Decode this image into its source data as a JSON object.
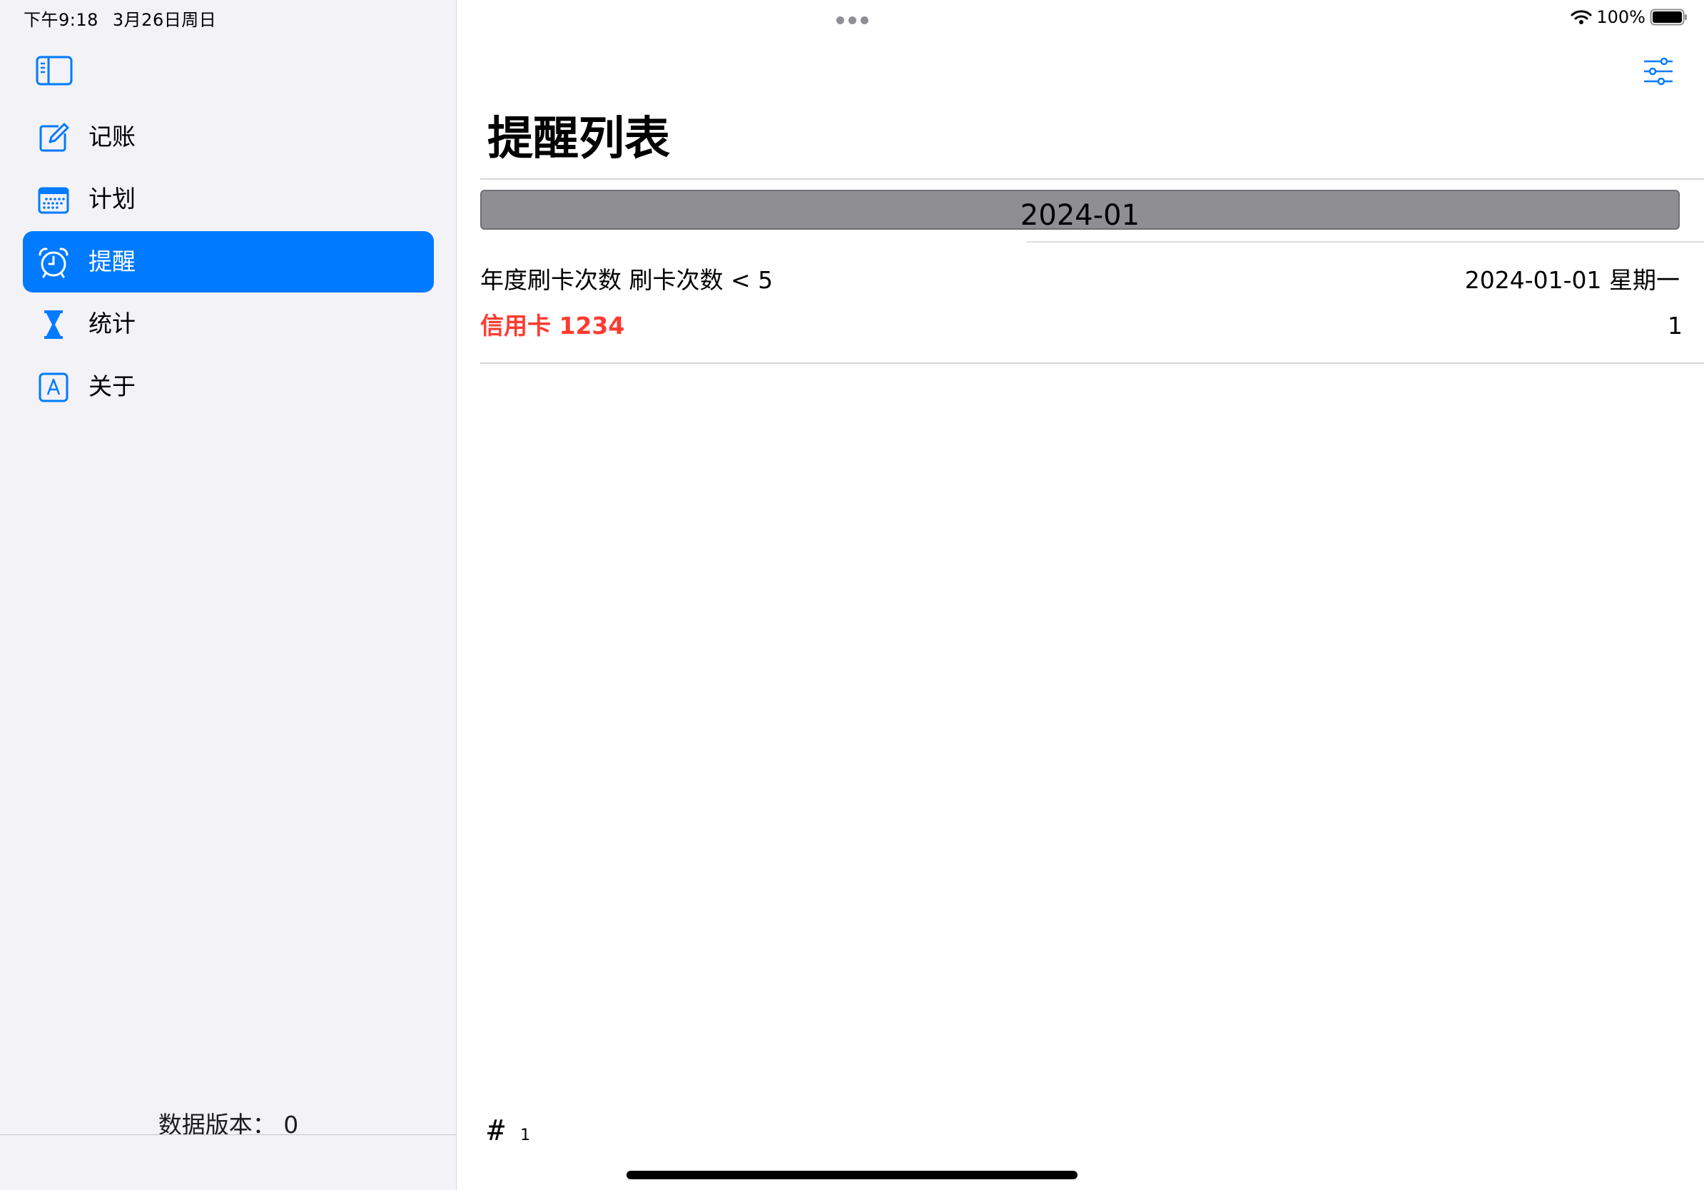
{
  "status_bar": {
    "time": "下午9:18",
    "date": "3月26日周日",
    "battery": "100%"
  },
  "sidebar": {
    "toggle_icon": "sidebar-toggle-icon",
    "items": [
      {
        "label": "记账",
        "icon": "square-and-pencil-icon",
        "active": false
      },
      {
        "label": "计划",
        "icon": "calendar-icon",
        "active": false
      },
      {
        "label": "提醒",
        "icon": "alarm-clock-icon",
        "active": true
      },
      {
        "label": "统计",
        "icon": "hourglass-icon",
        "active": false
      },
      {
        "label": "关于",
        "icon": "letter-a-square-icon",
        "active": false
      }
    ],
    "data_version": "数据版本：  0"
  },
  "main": {
    "filter_icon": "slider-filter-icon",
    "title": "提醒列表",
    "section": {
      "label": "2024-01"
    },
    "reminder": {
      "rule": "年度刷卡次数  刷卡次数 < 5",
      "date": "2024-01-01 星期一",
      "card": "信用卡 1234",
      "count": "1"
    },
    "footer": {
      "hash": "#",
      "count": "1"
    }
  },
  "colors": {
    "accent": "#007aff",
    "alert": "#ff3b30",
    "sidebar_bg": "#f2f2f7",
    "section_bg": "#8e8e93"
  }
}
